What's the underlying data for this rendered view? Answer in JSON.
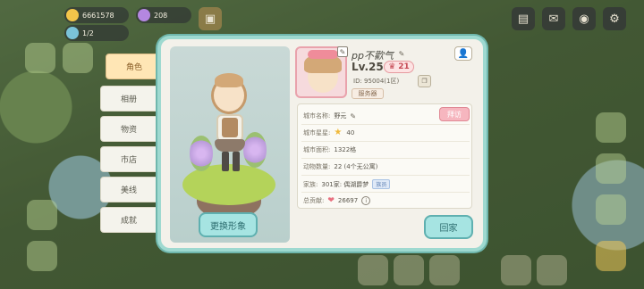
{
  "hud": {
    "coins": "6661578",
    "gems": "208",
    "stamina": "1/2"
  },
  "tabs": [
    {
      "label": "角色",
      "active": true
    },
    {
      "label": "相册",
      "active": false
    },
    {
      "label": "物资",
      "active": false
    },
    {
      "label": "市店",
      "active": false
    },
    {
      "label": "美线",
      "active": false
    },
    {
      "label": "成就",
      "active": false
    }
  ],
  "showcase": {
    "change_button": "更换形象"
  },
  "profile": {
    "name": "pp不歡气",
    "level": "Lv.25",
    "rank": "21",
    "uid": "ID: 95004(1区)",
    "server": "服务器"
  },
  "info": {
    "city_name_label": "城市名称:",
    "city_name_value": "野元",
    "visit_button": "拜访",
    "star_label": "城市星星:",
    "star_value": "40",
    "area_label": "城市面积:",
    "area_value": "1322格",
    "animals_label": "动物数量:",
    "animals_value": "22 (4个无公寓)",
    "family_label": "家族:",
    "family_value": "301家: 偶湖爵梦",
    "family_tag": "族员",
    "contrib_label": "总贡献:",
    "contrib_value": "26697"
  },
  "close_button": "回家",
  "colors": {
    "panel_border": "#9ed9d0",
    "active_tab": "#ffe6b5",
    "button": "#a6e4e2",
    "visit": "#f6b6bf"
  }
}
